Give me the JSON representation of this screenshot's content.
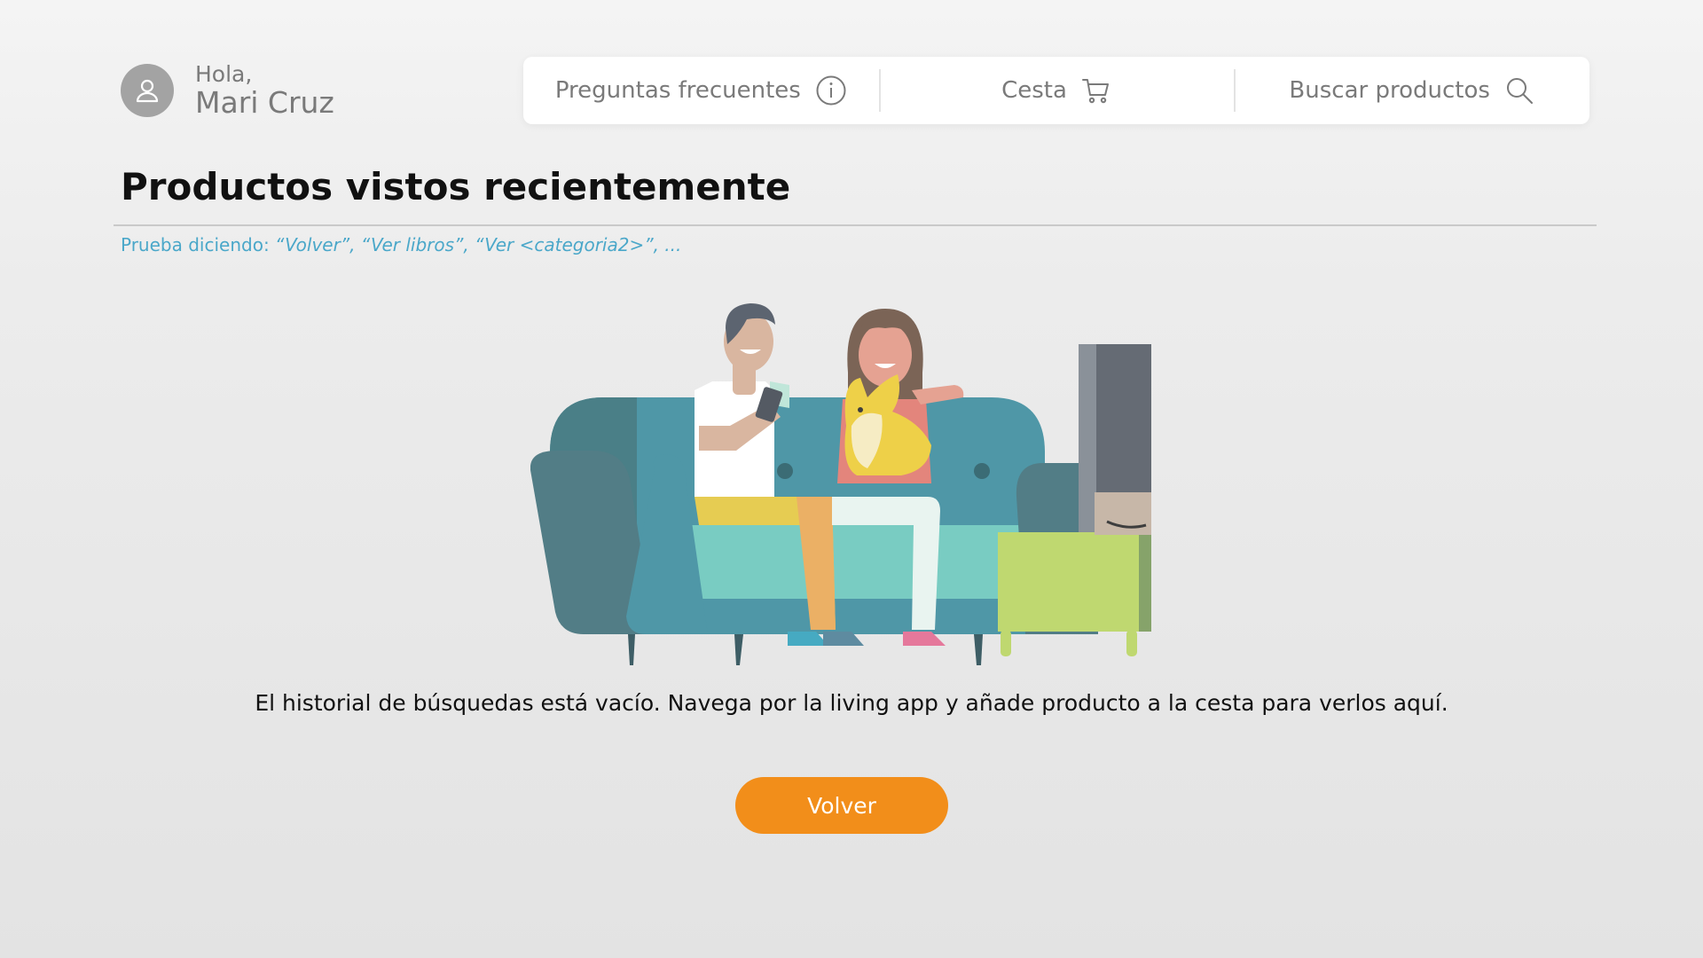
{
  "user": {
    "greeting": "Hola,",
    "name": "Mari Cruz",
    "avatar_icon": "user-icon"
  },
  "nav": {
    "faq_label": "Preguntas frecuentes",
    "faq_icon": "info-icon",
    "cart_label": "Cesta",
    "cart_icon": "cart-icon",
    "search_label": "Buscar productos",
    "search_icon": "search-icon"
  },
  "page": {
    "title": "Productos vistos recientemente",
    "hint_prefix": "Prueba diciendo: ",
    "hint_examples": "“Volver”, “Ver libros”, “Ver <categoria2>”, ...",
    "illustration": "couple-on-sofa-illustration",
    "empty_message": "El historial de búsquedas está vacío. Navega por la living app y añade producto a la cesta para verlos aquí.",
    "back_button": "Volver"
  },
  "colors": {
    "accent_orange": "#f28e1a",
    "hint_blue": "#4aa7c9",
    "muted_text": "#7a7a7a"
  }
}
